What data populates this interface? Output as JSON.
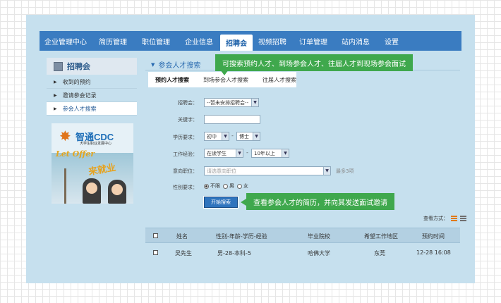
{
  "nav": {
    "items": [
      "企业管理中心",
      "简历管理",
      "职位管理",
      "企业信息",
      "招聘会",
      "视频招聘",
      "订单管理",
      "站内消息",
      "设置"
    ],
    "active_index": 4
  },
  "sidebar": {
    "title": "招聘会",
    "items": [
      {
        "label": "收到的预约"
      },
      {
        "label": "邀请参会记录"
      },
      {
        "label": "参会人才搜索"
      }
    ],
    "active_index": 2
  },
  "ad": {
    "logo": "智通CDC",
    "logo_sub": "大学生职业发展中心",
    "bubble": "Let Offer",
    "slogan": "来就业"
  },
  "main": {
    "section_title": "参会人才搜索",
    "tabs": [
      "预约人才搜索",
      "到场参会人才搜索",
      "往届人才搜索"
    ],
    "active_tab": 0
  },
  "tips": {
    "top": "可搜索预约人才、到场参会人才、往届人才到现场参会面试",
    "bottom": "查看参会人才的简历，并向其发送面试邀请"
  },
  "form": {
    "fair_label": "招聘会：",
    "fair_value": "--暂未安排招聘会--",
    "keyword_label": "关键字：",
    "keyword_value": "",
    "education_label": "学历要求：",
    "education_from": "初中",
    "education_to": "博士",
    "experience_label": "工作经验：",
    "experience_from": "在读学生",
    "experience_to": "10年以上",
    "position_label": "意向职位：",
    "position_placeholder": "请选意向职位",
    "position_hint": "最多3项",
    "gender_label": "性别要求：",
    "gender_options": [
      "不限",
      "男",
      "女"
    ],
    "gender_selected": 0,
    "search_button": "开始搜索",
    "dash": "-"
  },
  "view_mode": {
    "label": "查看方式："
  },
  "table": {
    "columns": [
      "姓名",
      "性别-年龄-学历-经验",
      "毕业院校",
      "希望工作地区",
      "预约时间"
    ],
    "rows": [
      {
        "name": "吴先生",
        "info": "男-28-本科-5",
        "school": "哈佛大学",
        "area": "东莞",
        "time": "12-28 16:08"
      }
    ]
  },
  "colors": {
    "nav_bg": "#3a7cc1",
    "panel_bg": "#c6e0ee",
    "tip_bg": "#3fa84d",
    "button_bg": "#2f74bd"
  }
}
